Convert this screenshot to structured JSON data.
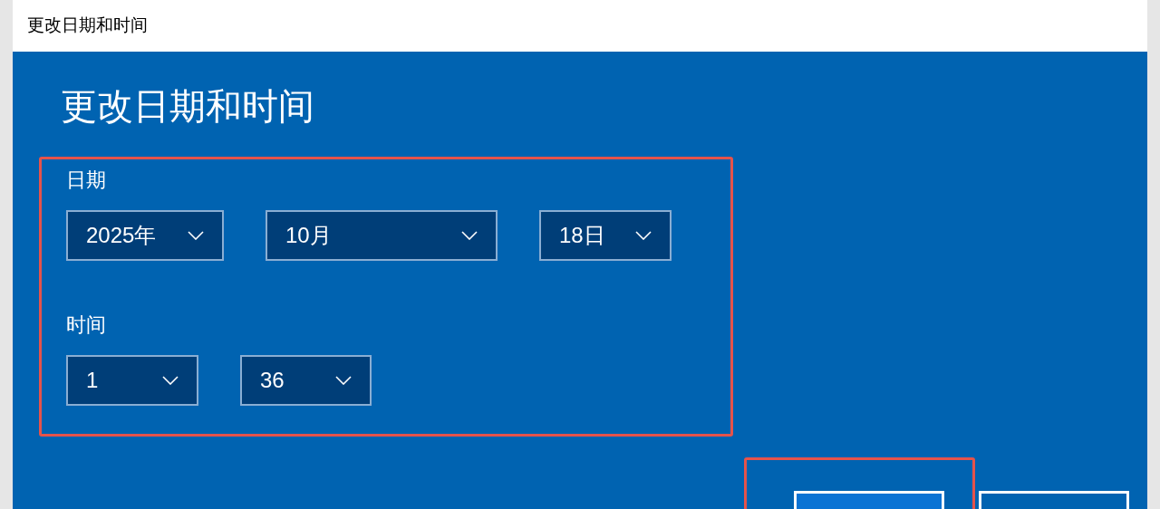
{
  "window": {
    "title": "更改日期和时间"
  },
  "heading": "更改日期和时间",
  "date_time_group": {
    "highlighted": true,
    "date": {
      "label": "日期",
      "dropdowns": [
        {
          "value": "2025年"
        },
        {
          "value": "10月"
        },
        {
          "value": "18日"
        }
      ]
    },
    "time": {
      "label": "时间",
      "dropdowns": [
        {
          "value": "1"
        },
        {
          "value": "36"
        }
      ]
    }
  },
  "buttons": [
    {
      "kind": "primary",
      "highlighted": true
    },
    {
      "kind": "secondary",
      "highlighted": false
    }
  ]
}
